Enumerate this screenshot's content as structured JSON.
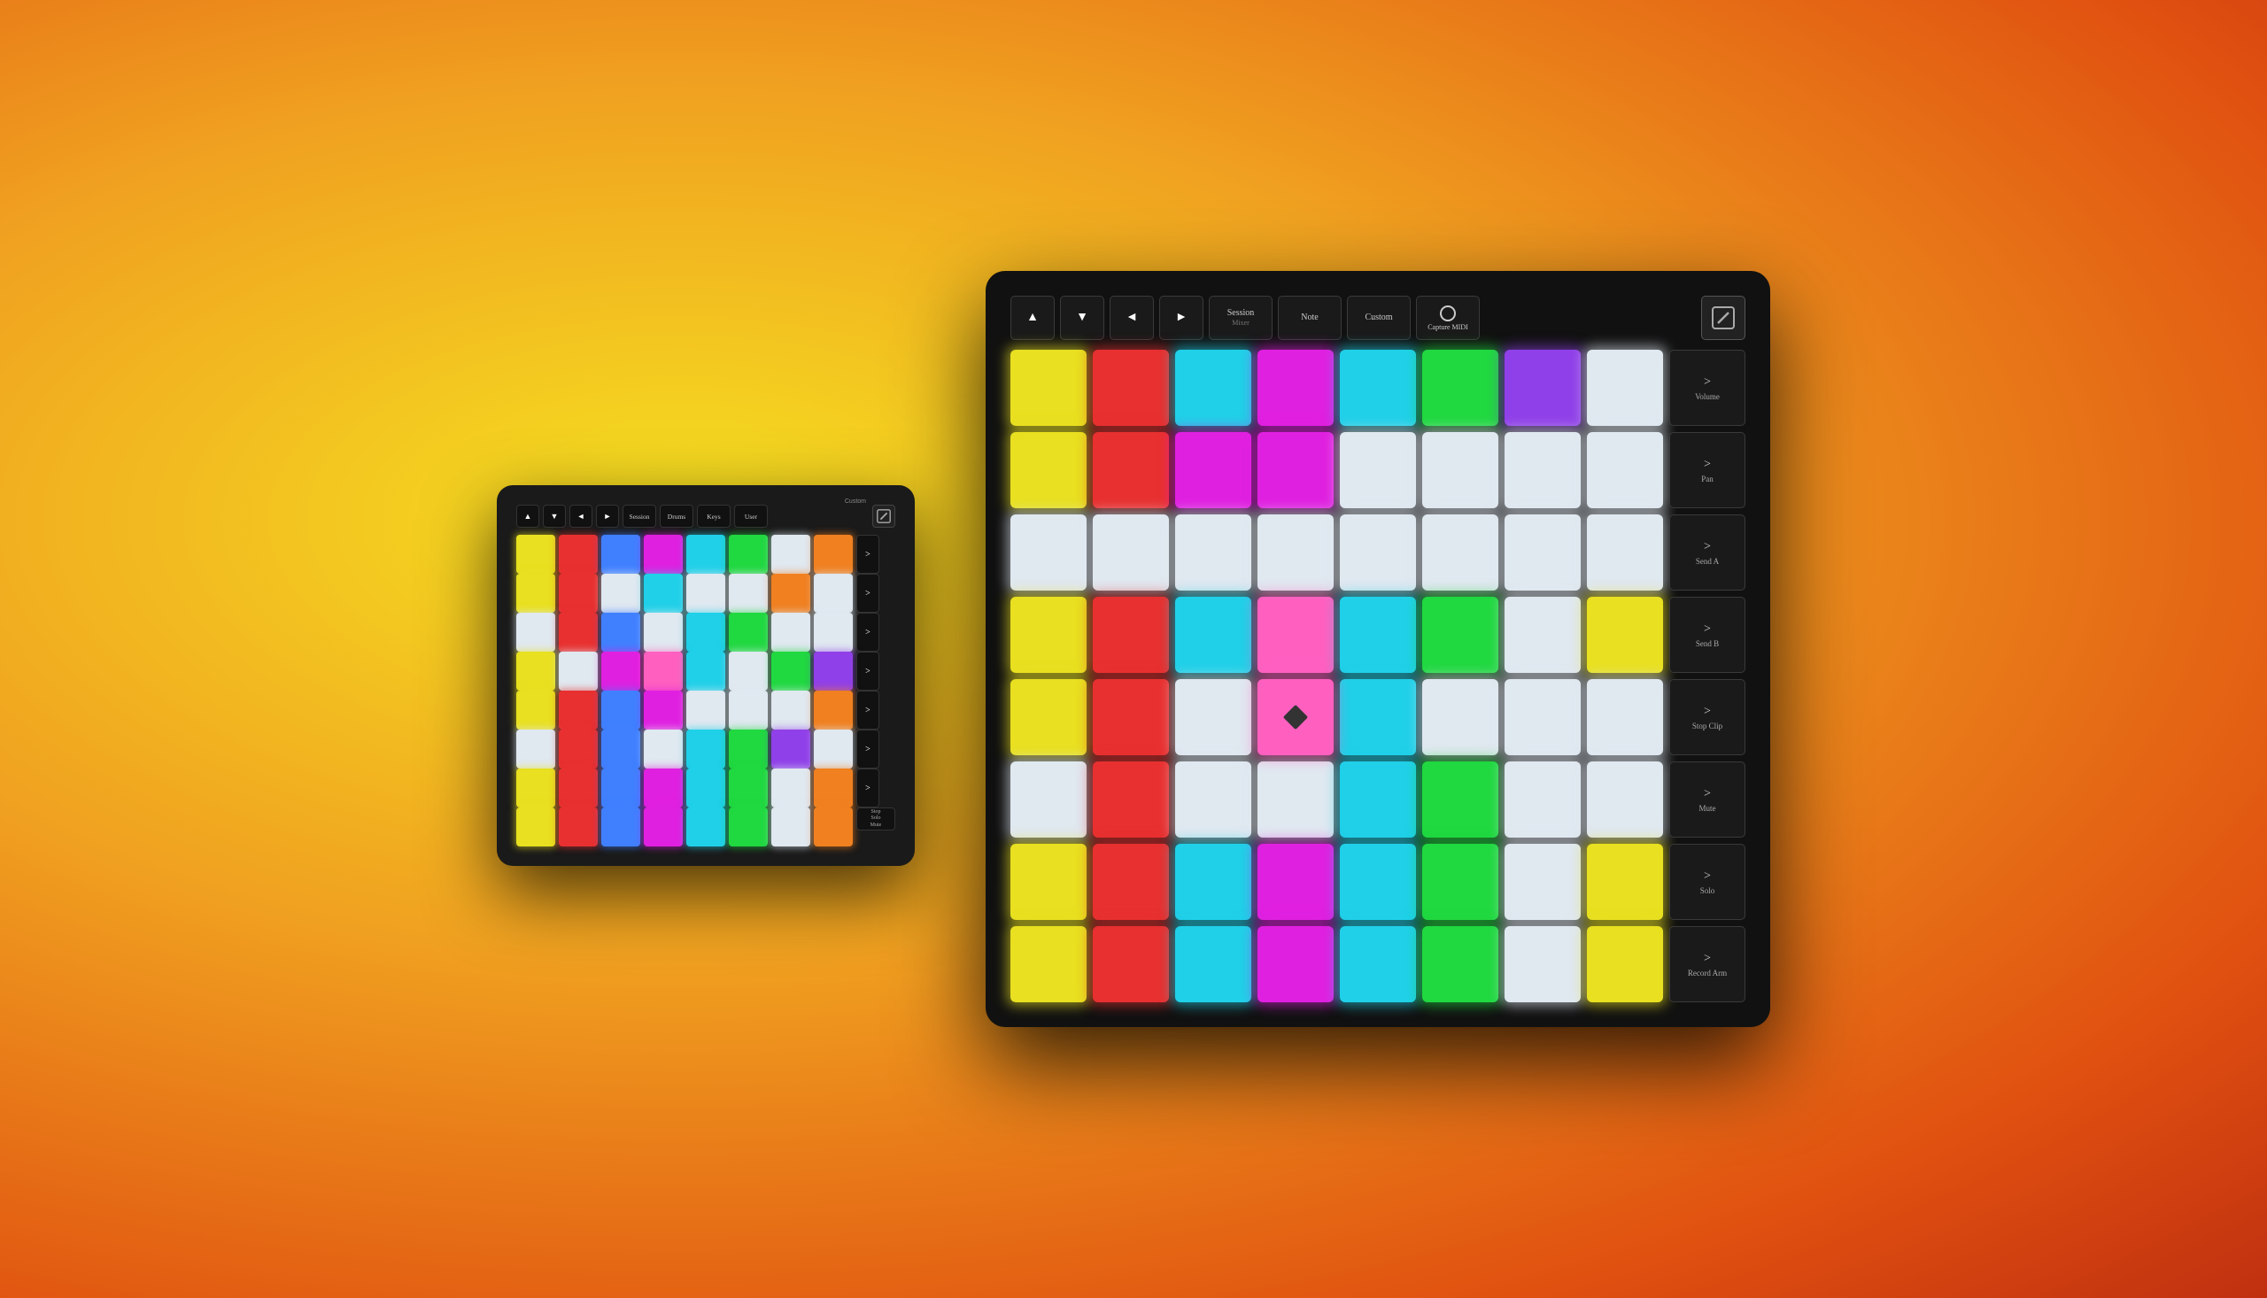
{
  "background": {
    "gradient": "radial orange-yellow"
  },
  "small_launchpad": {
    "custom_label": "Custom",
    "controls": {
      "up_arrow": "▲",
      "down_arrow": "▼",
      "left_arrow": "◄",
      "right_arrow": "►",
      "session_label": "Session",
      "drums_label": "Drums",
      "keys_label": "Keys",
      "user_label": "User"
    },
    "side_buttons": [
      ">",
      ">",
      ">",
      ">",
      ">",
      ">",
      ">"
    ],
    "bottom_right": "Stop\nSolo\nMute",
    "grid": [
      [
        "yellow",
        "red",
        "blue",
        "magenta",
        "cyan",
        "green",
        "white",
        "orange"
      ],
      [
        "yellow",
        "red",
        "white",
        "cyan",
        "white",
        "white",
        "orange",
        "white"
      ],
      [
        "white",
        "red",
        "blue",
        "white",
        "cyan",
        "green",
        "white",
        "white"
      ],
      [
        "yellow",
        "white",
        "magenta",
        "pink",
        "cyan",
        "white",
        "green",
        "purple"
      ],
      [
        "yellow",
        "red",
        "blue",
        "magenta",
        "white",
        "white",
        "white",
        "orange"
      ],
      [
        "white",
        "red",
        "blue",
        "white",
        "cyan",
        "green",
        "purple",
        "white"
      ],
      [
        "yellow",
        "red",
        "blue",
        "magenta",
        "cyan",
        "green",
        "white",
        "orange"
      ],
      [
        "yellow",
        "red",
        "blue",
        "magenta",
        "cyan",
        "green",
        "white",
        "orange"
      ]
    ]
  },
  "large_launchpad": {
    "controls": {
      "up_arrow": "▲",
      "down_arrow": "▼",
      "left_arrow": "◄",
      "right_arrow": "►",
      "session_label": "Session",
      "session_sub": "Mixer",
      "note_label": "Note",
      "custom_label": "Custom",
      "capture_label": "Capture MIDI"
    },
    "side_buttons": [
      {
        "arrow": ">",
        "label": "Volume"
      },
      {
        "arrow": ">",
        "label": "Pan"
      },
      {
        "arrow": ">",
        "label": "Send A"
      },
      {
        "arrow": ">",
        "label": "Send B"
      },
      {
        "arrow": ">",
        "label": "Stop Clip"
      },
      {
        "arrow": ">",
        "label": "Mute"
      },
      {
        "arrow": ">",
        "label": "Solo"
      },
      {
        "arrow": ">",
        "label": "Record Arm"
      }
    ],
    "grid": [
      [
        "yellow",
        "red",
        "cyan",
        "magenta",
        "cyan",
        "green",
        "purple",
        "white"
      ],
      [
        "yellow",
        "red",
        "magenta",
        "magenta",
        "white",
        "white",
        "white",
        "white"
      ],
      [
        "white",
        "white",
        "white",
        "white",
        "white",
        "white",
        "white",
        "white"
      ],
      [
        "yellow",
        "red",
        "cyan",
        "pink",
        "cyan",
        "green",
        "white",
        "yellow"
      ],
      [
        "yellow",
        "red",
        "white",
        "pink",
        "cyan",
        "white",
        "white",
        "white"
      ],
      [
        "white",
        "red",
        "white",
        "white",
        "cyan",
        "green",
        "white",
        "white"
      ],
      [
        "yellow",
        "red",
        "cyan",
        "magenta",
        "cyan",
        "green",
        "white",
        "yellow"
      ],
      [
        "yellow",
        "red",
        "cyan",
        "magenta",
        "cyan",
        "green",
        "white",
        "yellow"
      ]
    ]
  }
}
